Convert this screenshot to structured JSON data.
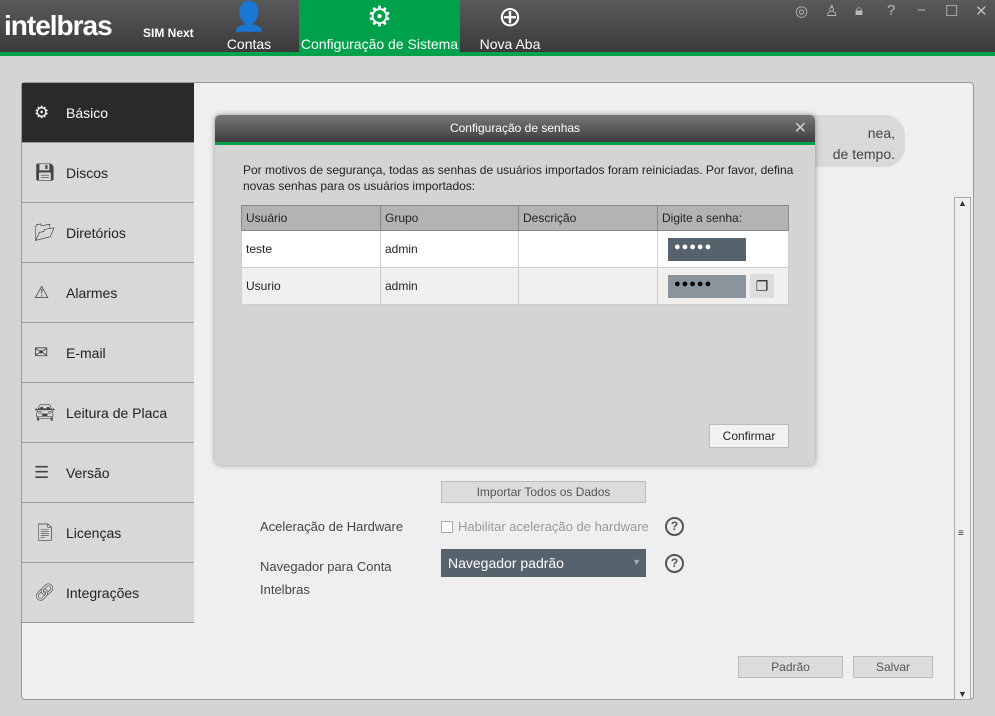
{
  "header": {
    "logo": "intelbras",
    "product": "SIM Next",
    "tabs": [
      {
        "label": "Contas",
        "icon": "user-icon"
      },
      {
        "label": "Configuração de Sistema",
        "icon": "gear-icon"
      },
      {
        "label": "Nova Aba",
        "icon": "plus-circle-icon"
      }
    ],
    "accent": "#00a14b"
  },
  "sidebar": {
    "items": [
      {
        "label": "Básico",
        "icon": "gear-icon"
      },
      {
        "label": "Discos",
        "icon": "disk-icon"
      },
      {
        "label": "Diretórios",
        "icon": "folder-icon"
      },
      {
        "label": "Alarmes",
        "icon": "warning-icon"
      },
      {
        "label": "E-mail",
        "icon": "mail-icon"
      },
      {
        "label": "Leitura de Placa",
        "icon": "car-icon"
      },
      {
        "label": "Versão",
        "icon": "list-icon"
      },
      {
        "label": "Licenças",
        "icon": "license-icon"
      },
      {
        "label": "Integrações",
        "icon": "link-icon"
      }
    ]
  },
  "main": {
    "bubble_line1": "nea,",
    "bubble_line2": "de tempo.",
    "import_all": "Importar Todos os Dados",
    "hw_label": "Aceleração de Hardware",
    "hw_checkbox": "Habilitar aceleração de hardware",
    "browser_label_1": "Navegador para Conta",
    "browser_label_2": "Intelbras",
    "browser_value": "Navegador padrão",
    "default_btn": "Padrão",
    "save_btn": "Salvar"
  },
  "dialog": {
    "title": "Configuração de senhas",
    "message": "Por motivos de segurança, todas as senhas de usuários importados foram reiniciadas. Por favor, defina novas senhas para os usuários importados:",
    "columns": [
      "Usuário",
      "Grupo",
      "Descrição",
      "Digite a senha:"
    ],
    "rows": [
      {
        "user": "teste",
        "group": "admin",
        "desc": "",
        "password": "●●●●●"
      },
      {
        "user": "Usurio",
        "group": "admin",
        "desc": "",
        "password": "●●●●●"
      }
    ],
    "confirm": "Confirmar"
  }
}
